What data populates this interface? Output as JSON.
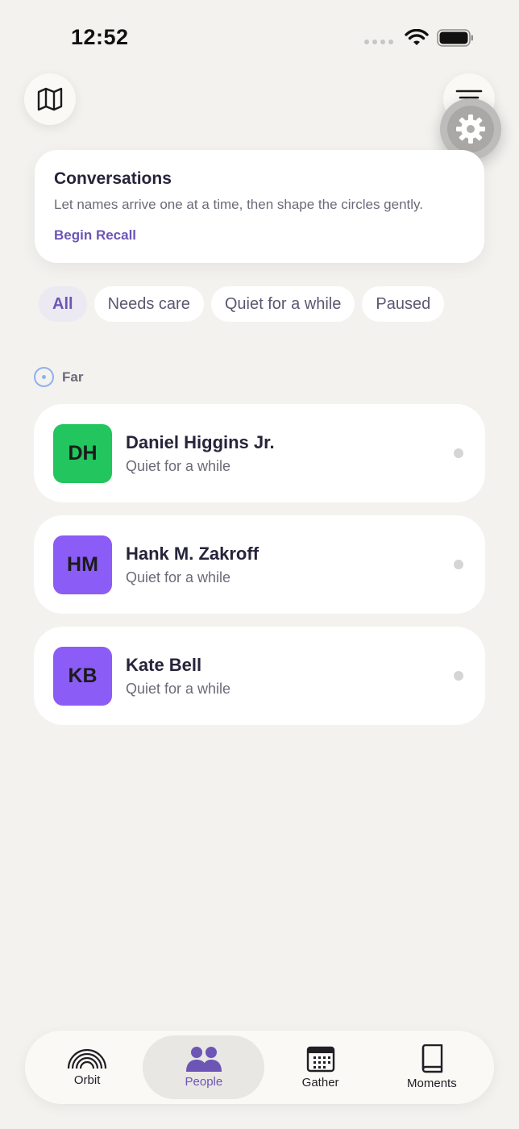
{
  "status_bar": {
    "time": "12:52"
  },
  "card": {
    "title": "Conversations",
    "text": "Let names arrive one at a time, then shape the circles gently.",
    "link": "Begin Recall"
  },
  "filters": [
    {
      "label": "All",
      "active": true
    },
    {
      "label": "Needs care",
      "active": false
    },
    {
      "label": "Quiet for a while",
      "active": false
    },
    {
      "label": "Paused",
      "active": false
    }
  ],
  "section": {
    "label": "Far"
  },
  "people": [
    {
      "initials": "DH",
      "name": "Daniel Higgins Jr.",
      "status": "Quiet for a while",
      "avatar_color": "#22c55e"
    },
    {
      "initials": "HM",
      "name": "Hank M. Zakroff",
      "status": "Quiet for a while",
      "avatar_color": "#8b5cf6"
    },
    {
      "initials": "KB",
      "name": "Kate Bell",
      "status": "Quiet for a while",
      "avatar_color": "#8b5cf6"
    }
  ],
  "tabs": [
    {
      "label": "Orbit",
      "icon": "rainbow-icon",
      "active": false
    },
    {
      "label": "People",
      "icon": "people-icon",
      "active": true
    },
    {
      "label": "Gather",
      "icon": "calendar-icon",
      "active": false
    },
    {
      "label": "Moments",
      "icon": "book-icon",
      "active": false
    }
  ],
  "colors": {
    "accent": "#6d55b5",
    "background": "#f3f2ef",
    "far_ring": "#8fb0ee"
  }
}
